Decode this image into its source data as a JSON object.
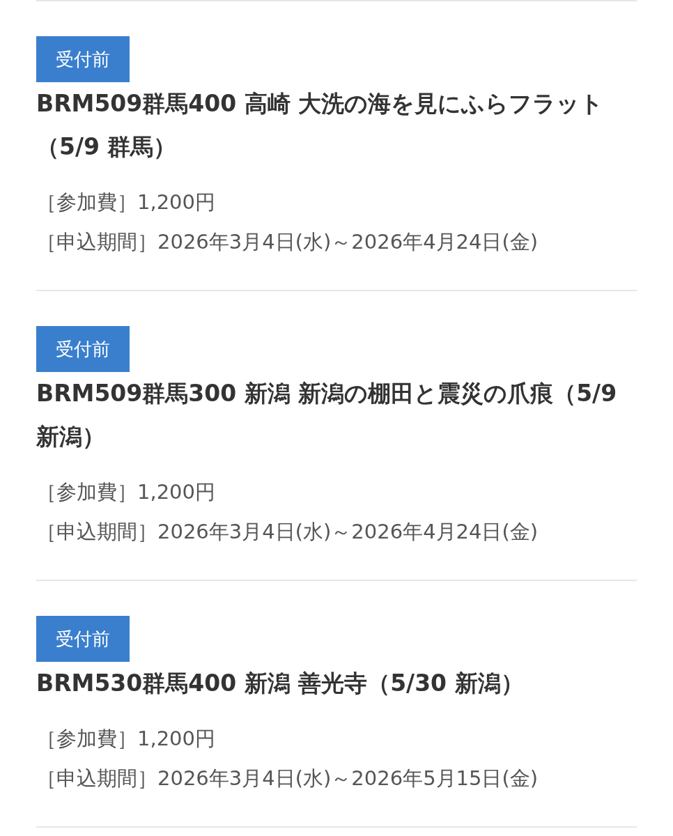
{
  "events": [
    {
      "status": "受付前",
      "title": "BRM509群馬400 高崎 大洗の海を見にふらフラット（5/9 群馬）",
      "fee": "［参加費］1,200円",
      "period": "［申込期間］2026年3月4日(水)～2026年4月24日(金)"
    },
    {
      "status": "受付前",
      "title": "BRM509群馬300 新潟 新潟の棚田と震災の爪痕（5/9 新潟）",
      "fee": "［参加費］1,200円",
      "period": "［申込期間］2026年3月4日(水)～2026年4月24日(金)"
    },
    {
      "status": "受付前",
      "title": "BRM530群馬400 新潟 善光寺（5/30 新潟）",
      "fee": "［参加費］1,200円",
      "period": "［申込期間］2026年3月4日(水)～2026年5月15日(金)"
    }
  ]
}
